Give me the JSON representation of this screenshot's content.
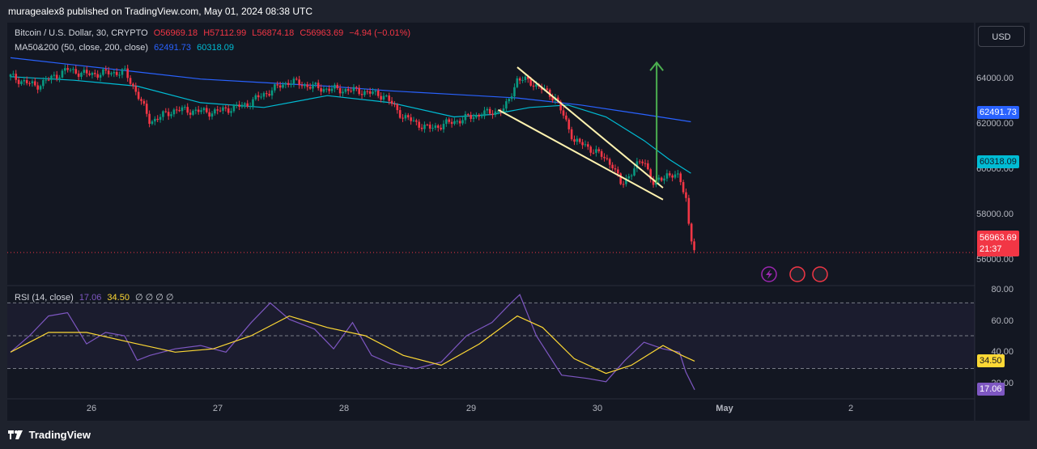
{
  "header": {
    "published_by": "muragealex8 published on TradingView.com, May 01, 2024 08:38 UTC"
  },
  "symbol_legend": {
    "symbol": "Bitcoin / U.S. Dollar, 30, CRYPTO",
    "open": "O56969.18",
    "high": "H57112.99",
    "low": "L56874.18",
    "close": "C56963.69",
    "change": "−4.94 (−0.01%)"
  },
  "ma_legend": {
    "name": "MA50&200 (50, close, 200, close)",
    "ma50": "62491.73",
    "ma200": "60318.09"
  },
  "rsi_legend": {
    "name": "RSI (14, close)",
    "rsi": "17.06",
    "ma": "34.50",
    "extras": "∅ ∅ ∅ ∅"
  },
  "currency_button": "USD",
  "price_axis": [
    "64000.00",
    "62000.00",
    "60000.00",
    "58000.00",
    "56000.00"
  ],
  "price_tags": {
    "ma_200": "62491.73",
    "ma_50": "60318.09",
    "last_price": "56963.69",
    "countdown": "21:37"
  },
  "rsi_axis": [
    "80.00",
    "60.00",
    "40.00",
    "20.00"
  ],
  "rsi_tags": {
    "rsi_ma": "34.50",
    "rsi": "17.06"
  },
  "time_axis": [
    "26",
    "27",
    "28",
    "29",
    "30",
    "May",
    "2"
  ],
  "footer": {
    "logo_text": "TradingView"
  },
  "colors": {
    "background": "#131722",
    "candle_up": "#089981",
    "candle_down": "#f23645",
    "ma_200": "#2962ff",
    "ma_50": "#00bcd4",
    "rsi_line": "#7e57c2",
    "rsi_ma": "#fdd835",
    "arrow": "#4caf50",
    "trendlines": "#fff3b0"
  },
  "chart_data": {
    "type": "candlestick",
    "x": [
      "26",
      "27",
      "28",
      "29",
      "30",
      "May",
      "2"
    ],
    "price_series": [
      {
        "t": 0.0,
        "v": 64400
      },
      {
        "t": 0.2,
        "v": 64000
      },
      {
        "t": 0.45,
        "v": 64700
      },
      {
        "t": 0.6,
        "v": 64500
      },
      {
        "t": 0.9,
        "v": 64600
      },
      {
        "t": 1.0,
        "v": 63700
      },
      {
        "t": 1.1,
        "v": 62500
      },
      {
        "t": 1.3,
        "v": 63000
      },
      {
        "t": 1.6,
        "v": 62900
      },
      {
        "t": 1.85,
        "v": 63200
      },
      {
        "t": 2.05,
        "v": 63800
      },
      {
        "t": 2.2,
        "v": 64200
      },
      {
        "t": 2.45,
        "v": 63900
      },
      {
        "t": 2.75,
        "v": 63800
      },
      {
        "t": 2.95,
        "v": 63600
      },
      {
        "t": 3.1,
        "v": 62700
      },
      {
        "t": 3.3,
        "v": 62200
      },
      {
        "t": 3.5,
        "v": 62500
      },
      {
        "t": 3.7,
        "v": 62800
      },
      {
        "t": 3.9,
        "v": 63000
      },
      {
        "t": 4.0,
        "v": 64300
      },
      {
        "t": 4.1,
        "v": 64200
      },
      {
        "t": 4.3,
        "v": 63500
      },
      {
        "t": 4.45,
        "v": 61700
      },
      {
        "t": 4.6,
        "v": 61300
      },
      {
        "t": 4.75,
        "v": 60700
      },
      {
        "t": 4.82,
        "v": 59800
      },
      {
        "t": 4.92,
        "v": 60500
      },
      {
        "t": 5.0,
        "v": 60900
      },
      {
        "t": 5.08,
        "v": 59800
      },
      {
        "t": 5.18,
        "v": 60300
      },
      {
        "t": 5.28,
        "v": 60100
      },
      {
        "t": 5.33,
        "v": 59400
      },
      {
        "t": 5.36,
        "v": 57800
      },
      {
        "t": 5.4,
        "v": 56964
      }
    ],
    "ma_50": [
      {
        "t": 0.0,
        "v": 64400
      },
      {
        "t": 0.5,
        "v": 64250
      },
      {
        "t": 1.0,
        "v": 64000
      },
      {
        "t": 1.5,
        "v": 63300
      },
      {
        "t": 2.0,
        "v": 63100
      },
      {
        "t": 2.5,
        "v": 63600
      },
      {
        "t": 3.0,
        "v": 63300
      },
      {
        "t": 3.5,
        "v": 62700
      },
      {
        "t": 3.8,
        "v": 62800
      },
      {
        "t": 4.1,
        "v": 63100
      },
      {
        "t": 4.4,
        "v": 63200
      },
      {
        "t": 4.7,
        "v": 62700
      },
      {
        "t": 5.0,
        "v": 61700
      },
      {
        "t": 5.2,
        "v": 60900
      },
      {
        "t": 5.37,
        "v": 60318
      }
    ],
    "ma_200": [
      {
        "t": 0.0,
        "v": 65200
      },
      {
        "t": 0.5,
        "v": 64900
      },
      {
        "t": 1.0,
        "v": 64600
      },
      {
        "t": 1.5,
        "v": 64300
      },
      {
        "t": 2.0,
        "v": 64150
      },
      {
        "t": 2.5,
        "v": 64000
      },
      {
        "t": 3.0,
        "v": 63800
      },
      {
        "t": 3.5,
        "v": 63650
      },
      {
        "t": 4.0,
        "v": 63500
      },
      {
        "t": 4.5,
        "v": 63200
      },
      {
        "t": 5.0,
        "v": 62800
      },
      {
        "t": 5.37,
        "v": 62492
      }
    ],
    "rsi": [
      {
        "t": 0.0,
        "v": 40
      },
      {
        "t": 0.15,
        "v": 50
      },
      {
        "t": 0.3,
        "v": 62
      },
      {
        "t": 0.45,
        "v": 64
      },
      {
        "t": 0.6,
        "v": 45
      },
      {
        "t": 0.75,
        "v": 52
      },
      {
        "t": 0.9,
        "v": 50
      },
      {
        "t": 1.0,
        "v": 35
      },
      {
        "t": 1.1,
        "v": 38
      },
      {
        "t": 1.3,
        "v": 42
      },
      {
        "t": 1.5,
        "v": 44
      },
      {
        "t": 1.7,
        "v": 40
      },
      {
        "t": 1.9,
        "v": 58
      },
      {
        "t": 2.05,
        "v": 70
      },
      {
        "t": 2.2,
        "v": 60
      },
      {
        "t": 2.4,
        "v": 54
      },
      {
        "t": 2.55,
        "v": 42
      },
      {
        "t": 2.7,
        "v": 58
      },
      {
        "t": 2.85,
        "v": 38
      },
      {
        "t": 3.0,
        "v": 33
      },
      {
        "t": 3.2,
        "v": 30
      },
      {
        "t": 3.4,
        "v": 34
      },
      {
        "t": 3.6,
        "v": 50
      },
      {
        "t": 3.8,
        "v": 58
      },
      {
        "t": 3.95,
        "v": 70
      },
      {
        "t": 4.02,
        "v": 75
      },
      {
        "t": 4.15,
        "v": 50
      },
      {
        "t": 4.35,
        "v": 26
      },
      {
        "t": 4.55,
        "v": 24
      },
      {
        "t": 4.7,
        "v": 22
      },
      {
        "t": 4.85,
        "v": 35
      },
      {
        "t": 5.0,
        "v": 46
      },
      {
        "t": 5.15,
        "v": 42
      },
      {
        "t": 5.28,
        "v": 40
      },
      {
        "t": 5.33,
        "v": 28
      },
      {
        "t": 5.4,
        "v": 17.06
      }
    ],
    "rsi_ma": [
      {
        "t": 0.0,
        "v": 40
      },
      {
        "t": 0.3,
        "v": 52
      },
      {
        "t": 0.6,
        "v": 52
      },
      {
        "t": 1.0,
        "v": 45
      },
      {
        "t": 1.3,
        "v": 40
      },
      {
        "t": 1.6,
        "v": 42
      },
      {
        "t": 1.9,
        "v": 50
      },
      {
        "t": 2.2,
        "v": 62
      },
      {
        "t": 2.5,
        "v": 55
      },
      {
        "t": 2.8,
        "v": 50
      },
      {
        "t": 3.1,
        "v": 38
      },
      {
        "t": 3.4,
        "v": 32
      },
      {
        "t": 3.7,
        "v": 45
      },
      {
        "t": 4.0,
        "v": 62
      },
      {
        "t": 4.2,
        "v": 55
      },
      {
        "t": 4.45,
        "v": 36
      },
      {
        "t": 4.7,
        "v": 27
      },
      {
        "t": 4.9,
        "v": 32
      },
      {
        "t": 5.15,
        "v": 44
      },
      {
        "t": 5.3,
        "v": 38
      },
      {
        "t": 5.4,
        "v": 34.5
      }
    ],
    "price_ylim": [
      55600,
      66000
    ],
    "rsi_ylim": [
      15,
      82
    ],
    "rsi_bands": [
      70,
      50,
      30
    ]
  }
}
